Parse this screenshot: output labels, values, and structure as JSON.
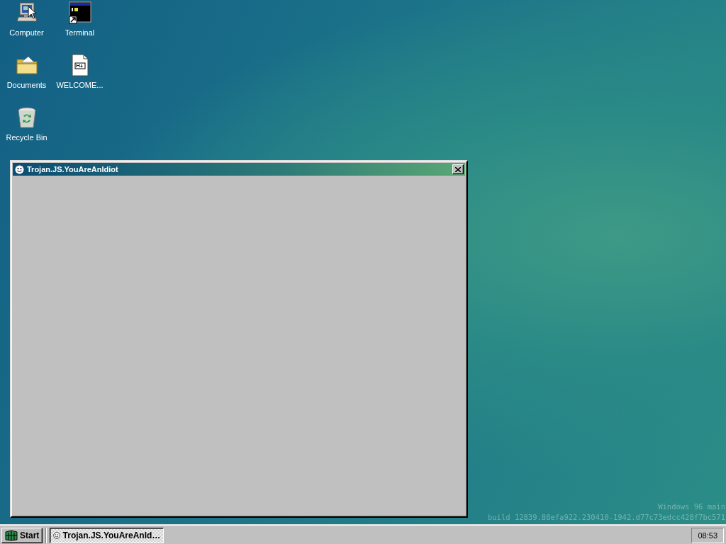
{
  "desktop": {
    "icons": [
      {
        "label": "Computer",
        "kind": "computer"
      },
      {
        "label": "Terminal",
        "kind": "terminal"
      },
      {
        "label": "Documents",
        "kind": "folder"
      },
      {
        "label": "WELCOME...",
        "kind": "markdown"
      },
      {
        "label": "Recycle Bin",
        "kind": "recycle-bin"
      }
    ],
    "version_lines": [
      "Windows 96 main",
      "build 12839.88efa922.230410-1942.d77c73edcc428f7bc571"
    ]
  },
  "window": {
    "title": "Trojan.JS.YouAreAnIdiot"
  },
  "taskbar": {
    "start_label": "Start",
    "tasks": [
      {
        "label": "Trojan.JS.YouAreAnId…",
        "selected": true
      }
    ],
    "clock": "08:53"
  }
}
